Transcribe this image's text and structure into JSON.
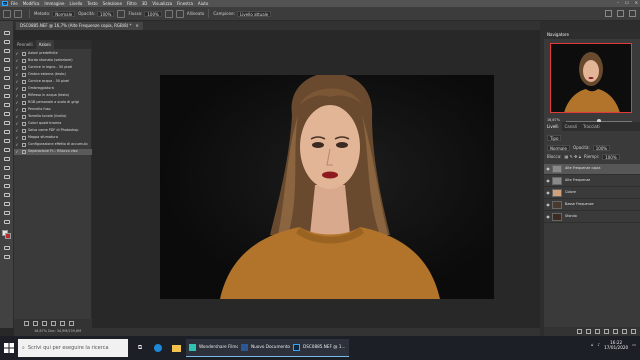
{
  "app": {
    "menu": [
      "File",
      "Modifica",
      "Immagine",
      "Livello",
      "Testo",
      "Selezione",
      "Filtro",
      "3D",
      "Visualizza",
      "Finestra",
      "Aiuto"
    ]
  },
  "options": {
    "preset": "Pennello",
    "mode_label": "Metodo:",
    "mode": "Normale",
    "opacity_label": "Opacità:",
    "opacity": "100%",
    "flow_label": "Flusso:",
    "flow": "100%",
    "airbrush_label": "Allineato",
    "sample_label": "Campione:",
    "sample": "Livello attuale"
  },
  "document": {
    "tab_title": "DSC0885.NEF @ 16,7% (Alte Frequenze copia, RGB/8) *"
  },
  "history": {
    "tabs": [
      "Pennelli",
      "Azioni"
    ],
    "items": [
      "Azioni predefinite",
      "Bordo sfumato (selezione)",
      "Cornice in legno - 50 pixel",
      "Ombra esterna (testo)",
      "Cornice acqua - 50 pixel",
      "Ombreggiatura",
      "Riflesso in acqua (testo)",
      "RGB personale a scala di grigi",
      "Pennello fuso",
      "Tornello tonale (livello)",
      "Colori quadricromia",
      "Salva come PDF di Photoshop",
      "Mappa sfumatura",
      "Configurazione effetto di accumulo",
      "Separazione Fr... Ritocco viso"
    ],
    "selected_index": 14
  },
  "status": {
    "text": "16,67%    Doc: 34,9M/139,6M"
  },
  "navigator": {
    "title": "Navigatore",
    "zoom": "16,67%",
    "zoom_fraction": 0.5
  },
  "layers_panel": {
    "tabs": [
      "Livelli",
      "Canali",
      "Tracciati"
    ],
    "filter_label": "Tipo",
    "blend": "Normale",
    "opacity_label": "Opacità:",
    "opacity": "100%",
    "lock_label": "Blocca:",
    "fill_label": "Riempi:",
    "fill": "100%",
    "layers": [
      {
        "name": "Alte Frequenze copia",
        "selected": true
      },
      {
        "name": "Alte Frequenze",
        "selected": false
      },
      {
        "name": "Colore",
        "selected": false
      },
      {
        "name": "Basse Frequenze",
        "selected": false
      },
      {
        "name": "Sfondo",
        "selected": false
      }
    ]
  },
  "taskbar": {
    "search_placeholder": "Scrivi qui per eseguire la ricerca",
    "windows": [
      "Wondershare Filmo...",
      "Nuovo Documento...",
      "DSC0885.NEF @ 1..."
    ],
    "time": "16:22",
    "date": "17/01/2020"
  },
  "colors": {
    "ui_background": "#282828",
    "panel": "#3a3a3a",
    "taskbar": "#1c1f26",
    "selection": "#575757",
    "sweater": "#b2742a",
    "lips": "#8e1a1f"
  }
}
